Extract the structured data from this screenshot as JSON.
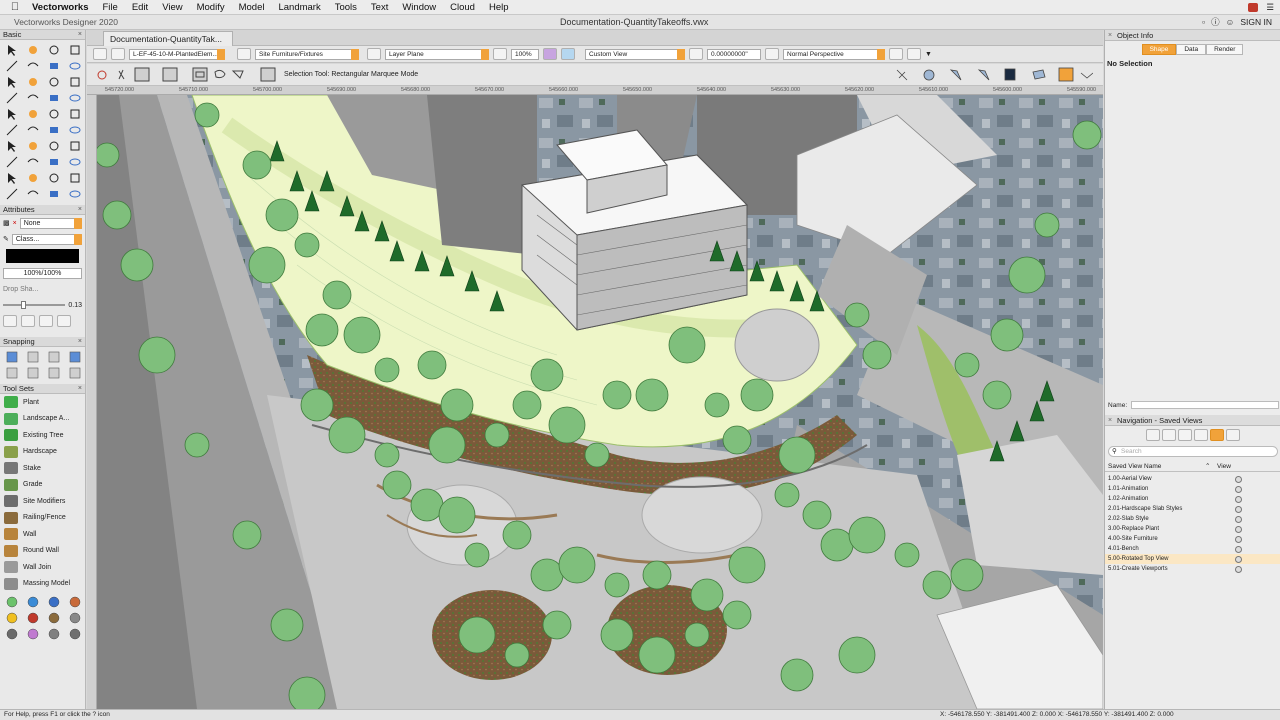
{
  "menubar": {
    "app": "Vectorworks",
    "items": [
      "File",
      "Edit",
      "View",
      "Modify",
      "Model",
      "Landmark",
      "Tools",
      "Text",
      "Window",
      "Cloud",
      "Help"
    ],
    "sign_in": "SIGN IN"
  },
  "titlebar": {
    "app_title": "Vectorworks Designer 2020",
    "document": "Documentation-QuantityTakeoffs.vwx"
  },
  "tab": {
    "label": "Documentation-QuantityTak..."
  },
  "viewbar": {
    "saved_view": "L-EF-45-10-M-PlantedElem...",
    "class": "Site Furniture/Fixtures",
    "layer_plane": "Layer Plane",
    "zoom": "100%",
    "view": "Custom View",
    "elevation": "0.00000000\"",
    "render_mode": "Normal Perspective"
  },
  "modebar": {
    "hint": "Selection Tool: Rectangular Marquee Mode"
  },
  "ruler": {
    "labels": [
      "545720.000",
      "545710.000",
      "545700.000",
      "545690.000",
      "545680.000",
      "545670.000",
      "545660.000",
      "545650.000",
      "545640.000",
      "545630.000",
      "545620.000",
      "545610.000",
      "545600.000",
      "545590.000"
    ]
  },
  "left_palette": {
    "basic_title": "Basic",
    "attributes_title": "Attributes",
    "fill_value": "None",
    "pen_value": "Class...",
    "opacity": "100%/100%",
    "drop_shadow": "Drop Sha...",
    "line_weight": "0.13",
    "snapping_title": "Snapping",
    "toolsets_title": "Tool Sets",
    "toolsets": [
      {
        "label": "Plant",
        "color": "#3fae4a"
      },
      {
        "label": "Landscape A...",
        "color": "#4cae5a"
      },
      {
        "label": "Existing Tree",
        "color": "#3a9f40"
      },
      {
        "label": "Hardscape",
        "color": "#8aa04a"
      },
      {
        "label": "Stake",
        "color": "#777777"
      },
      {
        "label": "Grade",
        "color": "#67964a"
      },
      {
        "label": "Site Modifiers",
        "color": "#6d6d6d"
      },
      {
        "label": "Railing/Fence",
        "color": "#8b6b3c"
      },
      {
        "label": "Wall",
        "color": "#b8843c"
      },
      {
        "label": "Round Wall",
        "color": "#b8843c"
      },
      {
        "label": "Wall Join",
        "color": "#9a9a9a"
      },
      {
        "label": "Massing Model",
        "color": "#8d8d8d"
      }
    ]
  },
  "object_info": {
    "title": "Object Info",
    "tabs": [
      "Shape",
      "Data",
      "Render"
    ],
    "selection": "No Selection",
    "name_label": "Name:"
  },
  "navigation": {
    "title": "Navigation - Saved Views",
    "search_placeholder": "Search",
    "col_name": "Saved View Name",
    "col_view": "View",
    "views": [
      "1.00-Aerial View",
      "1.01-Animation",
      "1.02-Animation",
      "2.01-Hardscape Slab Styles",
      "2.02-Slab Style",
      "3.00-Replace Plant",
      "4.00-Site Furniture",
      "4.01-Bench",
      "5.00-Rotated Top View",
      "5.01-Create Viewports"
    ],
    "selected_index": 8
  },
  "status": {
    "help": "For Help, press F1 or click the ? icon",
    "coords": "X: -546178.550   Y: -381491.400   Z: 0.000          X: -546178.550   Y: -381491.400   Z: 0.000"
  },
  "colors": {
    "accent": "#f1a23a",
    "lawn": "#eef6c8",
    "tree": "#7fbf7c",
    "conifer": "#1f6b2a",
    "paving": "#c7c7c7",
    "building": "#f2f2f2"
  }
}
